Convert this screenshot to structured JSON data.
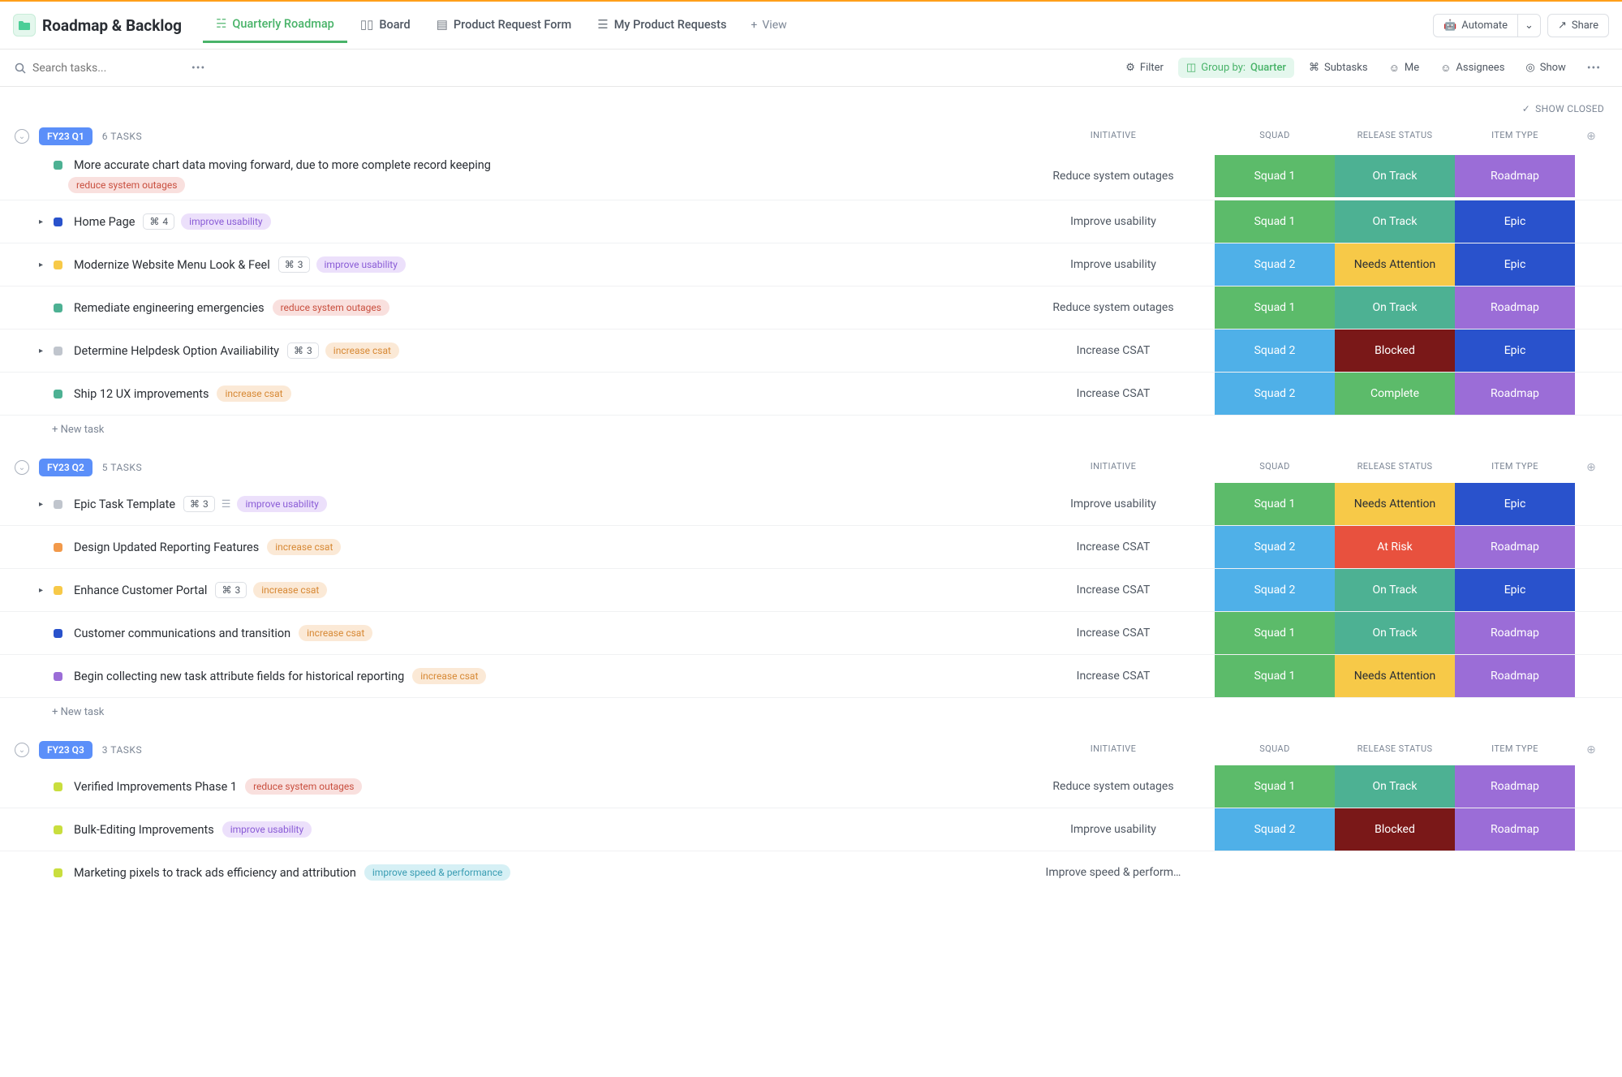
{
  "header": {
    "title": "Roadmap & Backlog",
    "tabs": [
      {
        "label": "Quarterly Roadmap",
        "active": true
      },
      {
        "label": "Board",
        "active": false
      },
      {
        "label": "Product Request Form",
        "active": false
      },
      {
        "label": "My Product Requests",
        "active": false
      }
    ],
    "add_view": "View",
    "automate": "Automate",
    "share": "Share"
  },
  "toolbar": {
    "search_placeholder": "Search tasks...",
    "filter": "Filter",
    "group_by_label": "Group by:",
    "group_by_value": "Quarter",
    "subtasks": "Subtasks",
    "me": "Me",
    "assignees": "Assignees",
    "show": "Show"
  },
  "show_closed": "SHOW CLOSED",
  "columns": {
    "initiative": "INITIATIVE",
    "squad": "SQUAD",
    "release_status": "RELEASE STATUS",
    "item_type": "ITEM TYPE"
  },
  "new_task": "+ New task",
  "groups": [
    {
      "name": "FY23 Q1",
      "count": "6 TASKS",
      "tasks": [
        {
          "expand": false,
          "dot": "st-teal",
          "title": "More accurate chart data moving forward, due to more complete record keeping",
          "twoline": true,
          "tags": [
            {
              "text": "reduce system outages",
              "cls": "tag-red"
            }
          ],
          "initiative": "Reduce system outages",
          "squad": "Squad 1",
          "squad_cls": "sq1",
          "status": "On Track",
          "status_cls": "ontrack",
          "type": "Roadmap",
          "type_cls": "roadmap"
        },
        {
          "expand": true,
          "dot": "st-blue",
          "title": "Home Page",
          "sub": "4",
          "tags": [
            {
              "text": "improve usability",
              "cls": "tag-purple"
            }
          ],
          "initiative": "Improve usability",
          "squad": "Squad 1",
          "squad_cls": "sq1",
          "status": "On Track",
          "status_cls": "ontrack",
          "type": "Epic",
          "type_cls": "epic"
        },
        {
          "expand": true,
          "dot": "st-yellow",
          "title": "Modernize Website Menu Look & Feel",
          "sub": "3",
          "tags": [
            {
              "text": "improve usability",
              "cls": "tag-purple"
            }
          ],
          "initiative": "Improve usability",
          "squad": "Squad 2",
          "squad_cls": "sq2",
          "status": "Needs Attention",
          "status_cls": "needsattn",
          "type": "Epic",
          "type_cls": "epic"
        },
        {
          "expand": false,
          "dot": "st-teal",
          "title": "Remediate engineering emergencies",
          "tags": [
            {
              "text": "reduce system outages",
              "cls": "tag-red"
            }
          ],
          "initiative": "Reduce system outages",
          "squad": "Squad 1",
          "squad_cls": "sq1",
          "status": "On Track",
          "status_cls": "ontrack",
          "type": "Roadmap",
          "type_cls": "roadmap"
        },
        {
          "expand": true,
          "dot": "st-gray",
          "title": "Determine Helpdesk Option Availiability",
          "sub": "3",
          "tags": [
            {
              "text": "increase csat",
              "cls": "tag-orange"
            }
          ],
          "initiative": "Increase CSAT",
          "squad": "Squad 2",
          "squad_cls": "sq2",
          "status": "Blocked",
          "status_cls": "blocked",
          "type": "Epic",
          "type_cls": "epic"
        },
        {
          "expand": false,
          "dot": "st-teal",
          "title": "Ship 12 UX improvements",
          "tags": [
            {
              "text": "increase csat",
              "cls": "tag-orange"
            }
          ],
          "initiative": "Increase CSAT",
          "squad": "Squad 2",
          "squad_cls": "sq2",
          "status": "Complete",
          "status_cls": "complete",
          "type": "Roadmap",
          "type_cls": "roadmap"
        }
      ]
    },
    {
      "name": "FY23 Q2",
      "count": "5 TASKS",
      "tasks": [
        {
          "expand": true,
          "dot": "st-gray",
          "title": "Epic Task Template",
          "sub": "3",
          "desc": true,
          "tags": [
            {
              "text": "improve usability",
              "cls": "tag-purple"
            }
          ],
          "initiative": "Improve usability",
          "squad": "Squad 1",
          "squad_cls": "sq1",
          "status": "Needs Attention",
          "status_cls": "needsattn",
          "type": "Epic",
          "type_cls": "epic"
        },
        {
          "expand": false,
          "dot": "st-orange",
          "title": "Design Updated Reporting Features",
          "tags": [
            {
              "text": "increase csat",
              "cls": "tag-orange"
            }
          ],
          "initiative": "Increase CSAT",
          "squad": "Squad 2",
          "squad_cls": "sq2",
          "status": "At Risk",
          "status_cls": "atrisk",
          "type": "Roadmap",
          "type_cls": "roadmap"
        },
        {
          "expand": true,
          "dot": "st-yellow",
          "title": "Enhance Customer Portal",
          "sub": "3",
          "tags": [
            {
              "text": "increase csat",
              "cls": "tag-orange"
            }
          ],
          "initiative": "Increase CSAT",
          "squad": "Squad 2",
          "squad_cls": "sq2",
          "status": "On Track",
          "status_cls": "ontrack",
          "type": "Epic",
          "type_cls": "epic"
        },
        {
          "expand": false,
          "dot": "st-blue",
          "title": "Customer communications and transition",
          "tags": [
            {
              "text": "increase csat",
              "cls": "tag-orange"
            }
          ],
          "initiative": "Increase CSAT",
          "squad": "Squad 1",
          "squad_cls": "sq1",
          "status": "On Track",
          "status_cls": "ontrack",
          "type": "Roadmap",
          "type_cls": "roadmap"
        },
        {
          "expand": false,
          "dot": "st-purple",
          "title": "Begin collecting new task attribute fields for historical reporting",
          "tags": [
            {
              "text": "increase csat",
              "cls": "tag-orange"
            }
          ],
          "initiative": "Increase CSAT",
          "squad": "Squad 1",
          "squad_cls": "sq1",
          "status": "Needs Attention",
          "status_cls": "needsattn",
          "type": "Roadmap",
          "type_cls": "roadmap"
        }
      ]
    },
    {
      "name": "FY23 Q3",
      "count": "3 TASKS",
      "tasks": [
        {
          "expand": false,
          "dot": "st-lime",
          "title": "Verified Improvements Phase 1",
          "tags": [
            {
              "text": "reduce system outages",
              "cls": "tag-red"
            }
          ],
          "initiative": "Reduce system outages",
          "squad": "Squad 1",
          "squad_cls": "sq1",
          "status": "On Track",
          "status_cls": "ontrack",
          "type": "Roadmap",
          "type_cls": "roadmap"
        },
        {
          "expand": false,
          "dot": "st-lime",
          "title": "Bulk-Editing Improvements",
          "tags": [
            {
              "text": "improve usability",
              "cls": "tag-purple"
            }
          ],
          "initiative": "Improve usability",
          "squad": "Squad 2",
          "squad_cls": "sq2",
          "status": "Blocked",
          "status_cls": "blocked",
          "type": "Roadmap",
          "type_cls": "roadmap"
        },
        {
          "expand": false,
          "dot": "st-lime",
          "title": "Marketing pixels to track ads efficiency and attribution",
          "tags": [
            {
              "text": "improve speed & performance",
              "cls": "tag-cyan"
            }
          ],
          "initiative": "Improve speed & perform…",
          "squad": "",
          "squad_cls": "",
          "status": "",
          "status_cls": "",
          "type": "",
          "type_cls": ""
        }
      ]
    }
  ]
}
